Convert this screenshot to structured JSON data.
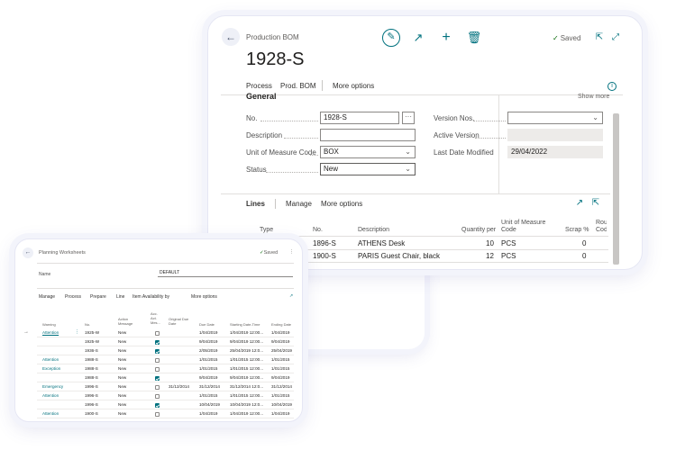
{
  "bom": {
    "caption": "Production BOM",
    "record": "1928-S",
    "saved": "Saved",
    "actions": [
      "Process",
      "Prod. BOM",
      "More options"
    ],
    "section": "General",
    "show_more": "Show more",
    "fields_left": [
      {
        "label": "No.",
        "value": "1928-S"
      },
      {
        "label": "Description",
        "value": ""
      },
      {
        "label": "Unit of Measure Code",
        "value": "BOX"
      },
      {
        "label": "Status",
        "value": "New"
      }
    ],
    "fields_right": [
      {
        "label": "Version Nos.",
        "value": ""
      },
      {
        "label": "Active Version",
        "value": ""
      },
      {
        "label": "Last Date Modified",
        "value": "29/04/2022"
      }
    ],
    "lines": {
      "title": "Lines",
      "actions": [
        "Manage",
        "More options"
      ],
      "headers": [
        "Type",
        "No.",
        "Description",
        "Quantity per",
        "Unit of Measure Code",
        "Scrap %",
        "Rou Cod"
      ],
      "rows": [
        {
          "no": "1896-S",
          "description": "ATHENS Desk",
          "qty": "10",
          "uom": "PCS",
          "scrap": "0"
        },
        {
          "no": "1900-S",
          "description": "PARIS Guest Chair, black",
          "qty": "12",
          "uom": "PCS",
          "scrap": "0"
        }
      ]
    },
    "accent": "#00717e"
  },
  "planning": {
    "caption": "Planning Worksheets",
    "saved": "Saved",
    "name_label": "Name",
    "name_value": "DEFAULT",
    "actions": [
      "Manage",
      "Process",
      "Prepare",
      "Line",
      "Item Availability by",
      "More options"
    ],
    "headers": [
      "Warning",
      "No.",
      "Action Message",
      "Acc. Act. Mes...",
      "Original Due Date",
      "Due Date",
      "Starting Date-Time",
      "Ending Date"
    ],
    "rows": [
      {
        "warning": "Attention",
        "no": "1925-W",
        "action": "New",
        "checked": false,
        "orig": "",
        "due": "1/04/2019",
        "start": "1/04/2019 12:00...",
        "end": "1/04/2019"
      },
      {
        "warning": "",
        "no": "1925-W",
        "action": "New",
        "checked": true,
        "orig": "",
        "due": "9/04/2019",
        "start": "9/04/2019 12:00...",
        "end": "9/04/2019"
      },
      {
        "warning": "",
        "no": "1936-S",
        "action": "New",
        "checked": true,
        "orig": "",
        "due": "2/05/2019",
        "start": "25/04/2019 12:0...",
        "end": "25/04/2019"
      },
      {
        "warning": "Attention",
        "no": "1988-S",
        "action": "New",
        "checked": false,
        "orig": "",
        "due": "1/01/2015",
        "start": "1/01/2015 12:00...",
        "end": "1/01/2015"
      },
      {
        "warning": "Exception",
        "no": "1988-S",
        "action": "New",
        "checked": false,
        "orig": "",
        "due": "1/01/2015",
        "start": "1/01/2015 12:00...",
        "end": "1/01/2015"
      },
      {
        "warning": "",
        "no": "1988-S",
        "action": "New",
        "checked": true,
        "orig": "",
        "due": "9/04/2019",
        "start": "9/04/2019 12:00...",
        "end": "9/04/2019"
      },
      {
        "warning": "Emergency",
        "no": "1996-S",
        "action": "New",
        "checked": false,
        "orig": "31/12/2014",
        "due": "31/12/2014",
        "start": "31/12/2014 12:0...",
        "end": "31/12/2014"
      },
      {
        "warning": "Attention",
        "no": "1996-S",
        "action": "New",
        "checked": false,
        "orig": "",
        "due": "1/01/2015",
        "start": "1/01/2015 12:00...",
        "end": "1/01/2015"
      },
      {
        "warning": "",
        "no": "1996-S",
        "action": "New",
        "checked": true,
        "orig": "",
        "due": "10/04/2019",
        "start": "10/04/2019 12:0...",
        "end": "10/04/2019"
      },
      {
        "warning": "Attention",
        "no": "1900-S",
        "action": "New",
        "checked": false,
        "orig": "",
        "due": "1/04/2019",
        "start": "1/04/2019 12:00...",
        "end": "1/04/2019"
      }
    ]
  }
}
